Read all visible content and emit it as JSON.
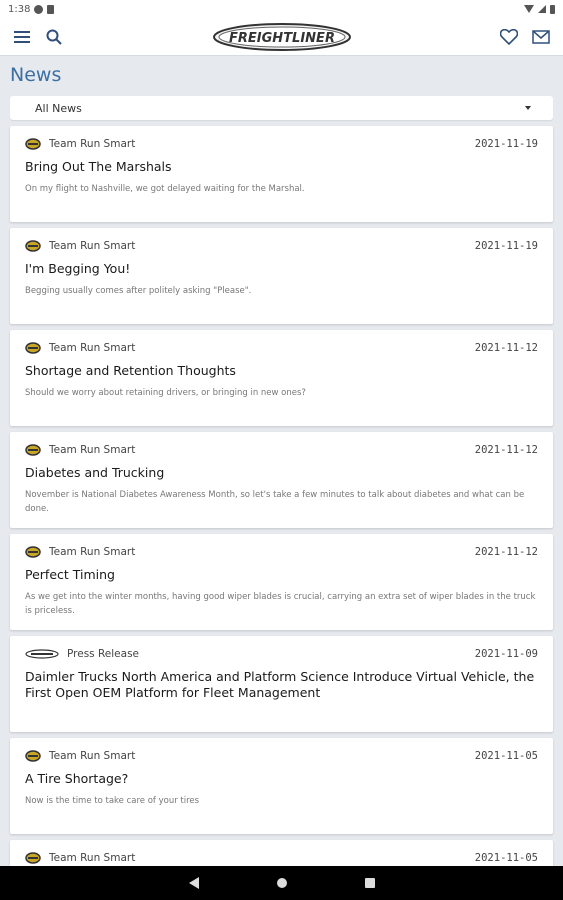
{
  "status_bar": {
    "time": "1:38"
  },
  "header": {
    "logo_text": "FREIGHTLINER",
    "menu_icon": "menu-icon",
    "search_icon": "search-icon",
    "favorite_icon": "heart-icon",
    "mail_icon": "mail-icon"
  },
  "page": {
    "title": "News"
  },
  "filter": {
    "selected": "All News"
  },
  "articles": [
    {
      "source": "Team Run Smart",
      "date": "2021-11-19",
      "title": "Bring Out The Marshals",
      "desc": "On my flight to Nashville, we got delayed waiting for the Marshal."
    },
    {
      "source": "Team Run Smart",
      "date": "2021-11-19",
      "title": "I'm Begging You!",
      "desc": "Begging usually comes after politely asking \"Please\"."
    },
    {
      "source": "Team Run Smart",
      "date": "2021-11-12",
      "title": "Shortage and Retention Thoughts",
      "desc": "Should we worry about retaining drivers, or bringing in new ones?"
    },
    {
      "source": "Team Run Smart",
      "date": "2021-11-12",
      "title": "Diabetes and Trucking",
      "desc": "November is National Diabetes Awareness Month, so let's take a few minutes to talk about diabetes and what can be done."
    },
    {
      "source": "Team Run Smart",
      "date": "2021-11-12",
      "title": "Perfect Timing",
      "desc": "As we get into the winter months, having good wiper blades is crucial, carrying an extra set of wiper blades in the truck is priceless."
    },
    {
      "source": "Press Release",
      "date": "2021-11-09",
      "title": "Daimler Trucks North America and Platform Science Introduce Virtual Vehicle, the First Open OEM Platform for Fleet Management",
      "desc": ""
    },
    {
      "source": "Team Run Smart",
      "date": "2021-11-05",
      "title": "A Tire Shortage?",
      "desc": "Now is the time to take care of your tires"
    },
    {
      "source": "Team Run Smart",
      "date": "2021-11-05",
      "title": "",
      "desc": ""
    }
  ],
  "colors": {
    "accent": "#3d6fa3",
    "background": "#e6e9ee"
  }
}
